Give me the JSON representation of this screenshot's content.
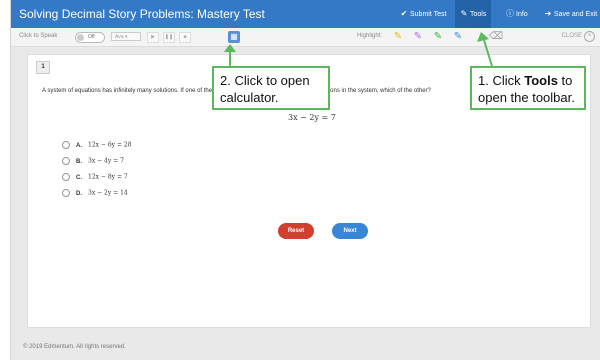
{
  "header": {
    "title": "Solving Decimal Story Problems: Mastery Test",
    "buttons": [
      {
        "label": "Submit Test",
        "icon": "check-circle-icon"
      },
      {
        "label": "Tools",
        "icon": "wrench-icon"
      },
      {
        "label": "Info",
        "icon": "info-icon"
      },
      {
        "label": "Save and Exit",
        "icon": "exit-icon"
      }
    ]
  },
  "toolbar": {
    "click_to_speak": "Click to Speak",
    "toggle_state": "Off",
    "voice_select": "Ava",
    "highlight_label": "Highlight:",
    "close_label": "CLOSE"
  },
  "question": {
    "number": "1",
    "text": "A system of equations has infinitely many solutions. If one of the equations in the system, which of the equations in the system, which of the other?",
    "equation": "3x − 2y = 7",
    "options": [
      {
        "letter": "A.",
        "expr": "12x − 6y = 28"
      },
      {
        "letter": "B.",
        "expr": "3x − 4y = 7"
      },
      {
        "letter": "C.",
        "expr": "12x − 8y = 7"
      },
      {
        "letter": "D.",
        "expr": "3x − 2y = 14"
      }
    ]
  },
  "actions": {
    "reset": "Reset",
    "next": "Next"
  },
  "footer": "© 2019 Edmentum. All rights reserved.",
  "callouts": {
    "tools_prefix": "1. Click ",
    "tools_bold": "Tools",
    "tools_suffix": " to open the toolbar.",
    "calc": "2. Click to open calculator."
  },
  "colors": {
    "header": "#3379c6",
    "callout_border": "#5cb85c",
    "reset": "#d1402f",
    "next": "#3a86d6"
  }
}
